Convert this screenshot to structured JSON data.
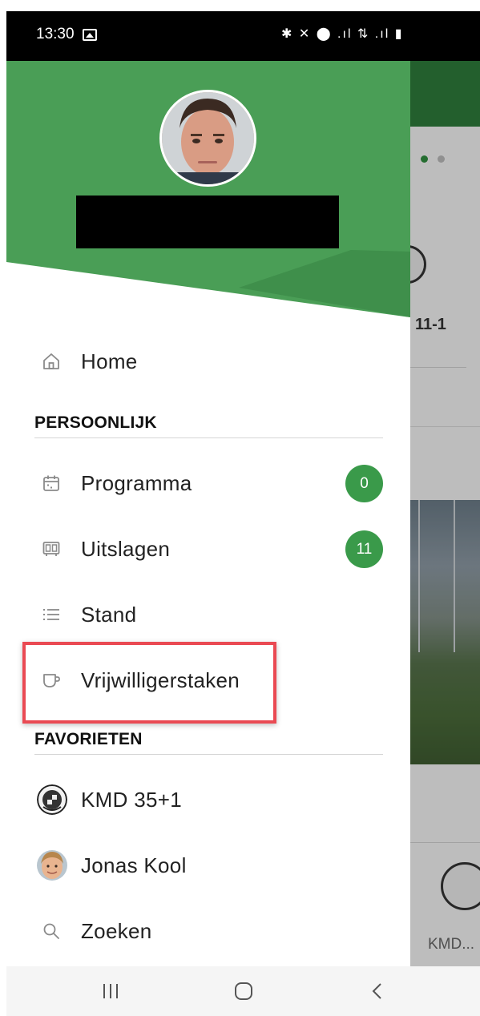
{
  "status_bar": {
    "time": "13:30",
    "icons": "✱ ✕ ⬤ .ıl ⇅ .ıl ▮"
  },
  "drawer": {
    "menu": {
      "home": "Home",
      "section_personal": "PERSOONLIJK",
      "programma": "Programma",
      "programma_count": "0",
      "uitslagen": "Uitslagen",
      "uitslagen_count": "11",
      "stand": "Stand",
      "vrijwilligerstaken": "Vrijwilligerstaken",
      "section_favorites": "FAVORIETEN",
      "fav_team": "KMD 35+1",
      "fav_person": "Jonas Kool",
      "zoeken": "Zoeken"
    }
  },
  "background_app": {
    "team_label": "11-1",
    "club_label": "KMD..."
  },
  "colors": {
    "header_green": "#4a9e56",
    "badge_green": "#3a9a4a",
    "highlight_red": "#ea4a53"
  }
}
